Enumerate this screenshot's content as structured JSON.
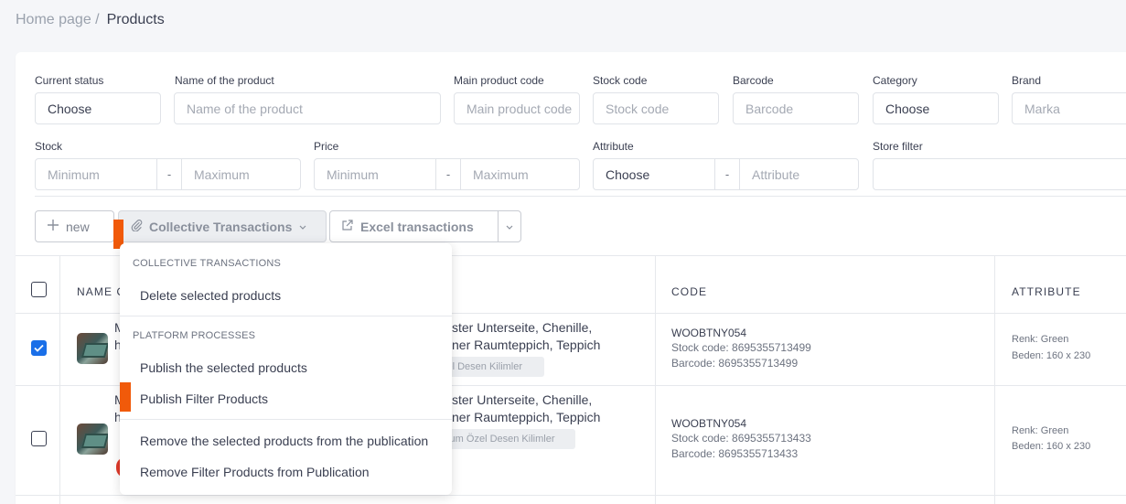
{
  "breadcrumb": {
    "home": "Home page /",
    "current": "Products"
  },
  "filters": {
    "current_status": {
      "label": "Current status",
      "value": "Choose"
    },
    "product_name": {
      "label": "Name of the product",
      "placeholder": "Name of the product"
    },
    "main_code": {
      "label": "Main product code",
      "placeholder": "Main product code"
    },
    "stock_code": {
      "label": "Stock code",
      "placeholder": "Stock code"
    },
    "barcode": {
      "label": "Barcode",
      "placeholder": "Barcode"
    },
    "category": {
      "label": "Category",
      "value": "Choose"
    },
    "brand": {
      "label": "Brand",
      "placeholder": "Marka"
    },
    "stock": {
      "label": "Stock",
      "min": "Minimum",
      "sep": "-",
      "max": "Maximum"
    },
    "price": {
      "label": "Price",
      "min": "Minimum",
      "sep": "-",
      "max": "Maximum"
    },
    "attribute": {
      "label": "Attribute",
      "value": "Choose",
      "sep": "-",
      "placeholder": "Attribute"
    },
    "store": {
      "label": "Store filter",
      "value": ""
    }
  },
  "toolbar": {
    "new_label": "new",
    "collective_label": "Collective Transactions",
    "excel_label": "Excel transactions"
  },
  "table": {
    "headers": {
      "name": "NAME O",
      "code": "CODE",
      "attribute": "ATTRIBUTE"
    },
    "rows": [
      {
        "checked": true,
        "name_prefix_1": "M",
        "name_prefix_2": "h",
        "title_line1": "ster Unterseite, Chenille,",
        "title_line2": "ner Raumteppich, Teppich",
        "tag": "zel Desen Kilimler",
        "code": "WOOBTNY054",
        "stock_code": "Stock code: 8695355713499",
        "barcode": "Barcode: 8695355713499",
        "color": "Renk: Green",
        "size": "Beden: 160 x 230"
      },
      {
        "checked": false,
        "name_prefix_1": "M",
        "name_prefix_2": "h",
        "title_line1": "ster Unterseite, Chenille,",
        "title_line2": "ner Raumteppich, Teppich",
        "tag": "nium Özel Desen Kilimler",
        "code": "WOOBTNY054",
        "stock_code": "Stock code: 8695355713433",
        "barcode": "Barcode: 8695355713433",
        "color": "Renk: Green",
        "size": "Beden: 160 x 230"
      }
    ]
  },
  "dropdown": {
    "section1": "COLLECTIVE TRANSACTIONS",
    "delete": "Delete selected products",
    "section2": "PLATFORM PROCESSES",
    "publish_selected": "Publish the selected products",
    "publish_filter": "Publish Filter Products",
    "remove_selected": "Remove the selected products from the publication",
    "remove_filter": "Remove Filter Products from Publication"
  },
  "colors": {
    "accent": "#1a6fe8",
    "highlight": "#f15a0a"
  }
}
